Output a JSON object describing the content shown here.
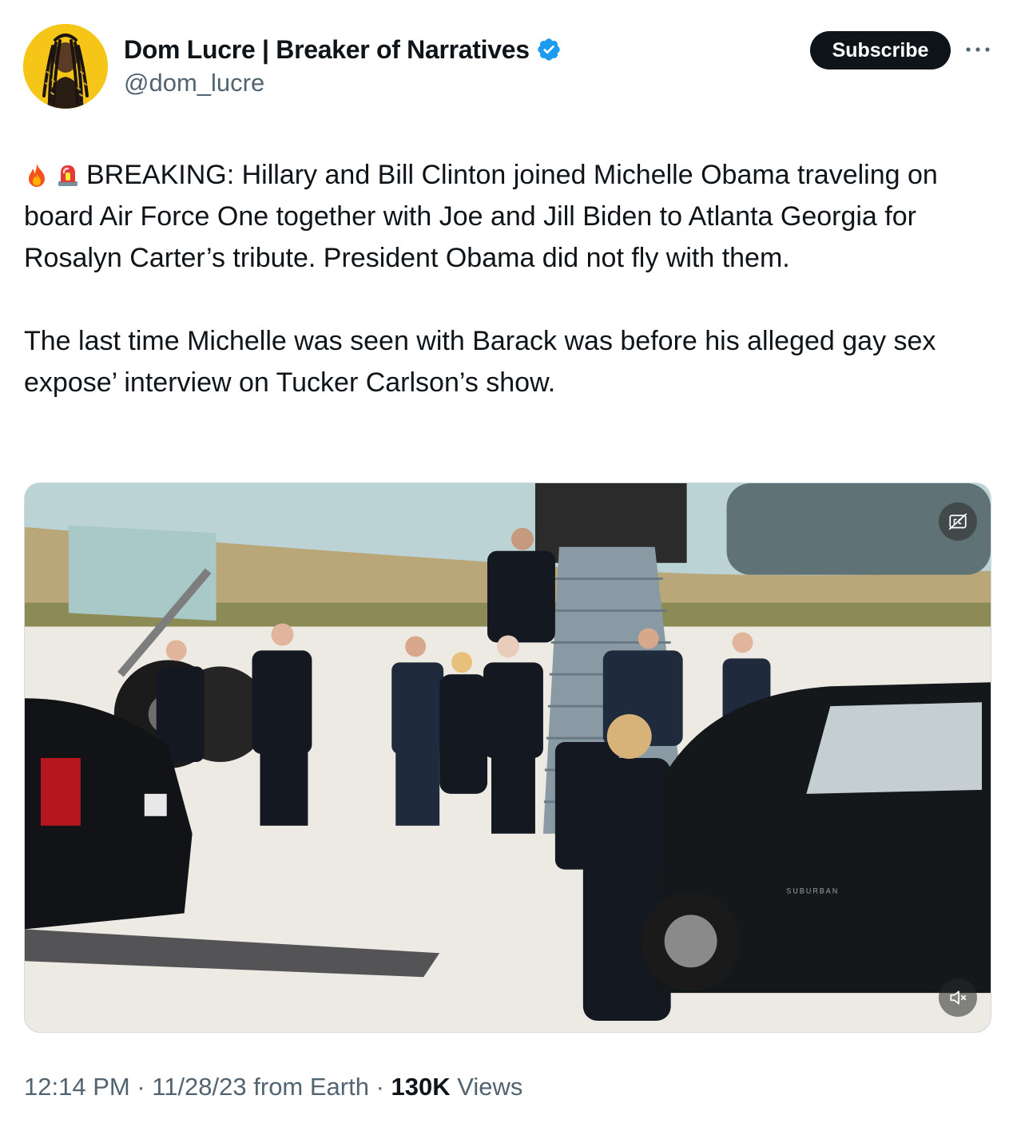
{
  "author": {
    "display_name": "Dom Lucre | Breaker of Narratives",
    "handle": "@dom_lucre",
    "verified": true,
    "avatar_bg": "#f5c518"
  },
  "actions": {
    "subscribe_label": "Subscribe",
    "more_icon": "ellipsis-icon"
  },
  "tweet": {
    "emojis": [
      "fire-emoji",
      "rotating-light-emoji"
    ],
    "paragraph_1": "BREAKING: Hillary and Bill Clinton joined Michelle Obama traveling on board Air Force One together with Joe and Jill Biden to Atlanta Georgia for Rosalyn Carter’s tribute. President Obama did not fly with them.",
    "paragraph_2": "The last time Michelle was seen with Barack was before his alleged gay sex expose’ interview on Tucker Carlson’s show."
  },
  "media": {
    "type": "video",
    "captions_icon": "captions-off-icon",
    "mute_icon": "muted-speaker-icon",
    "vehicle_badge": "SUBURBAN"
  },
  "meta": {
    "time": "12:14 PM",
    "separator_1": " · ",
    "date": "11/28/23",
    "source": " from Earth",
    "separator_2": " · ",
    "views_count": "130K",
    "views_label": " Views"
  },
  "colors": {
    "text_primary": "#0f1419",
    "text_secondary": "#536471",
    "verified_blue": "#1d9bf0",
    "button_dark": "#0f1419"
  }
}
